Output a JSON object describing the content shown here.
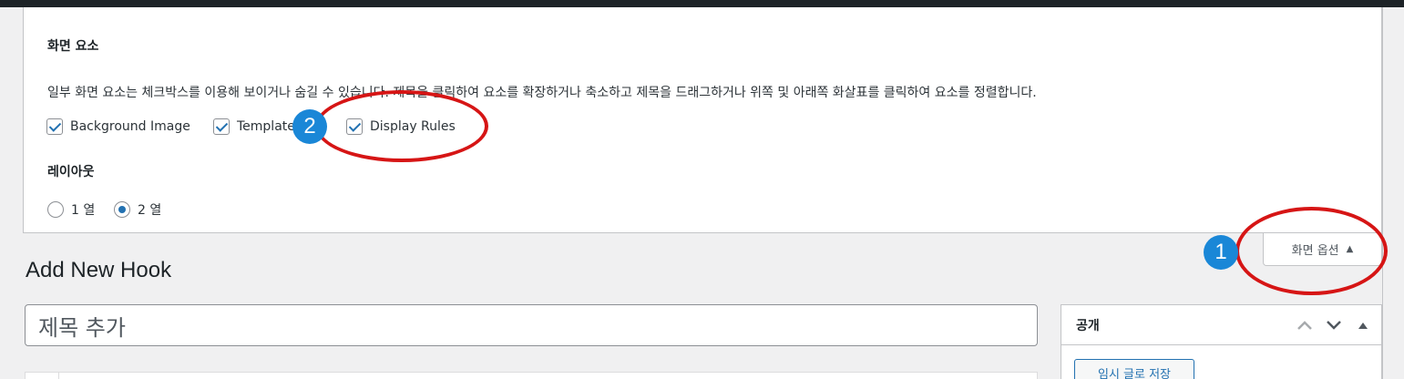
{
  "screen_options": {
    "heading": "화면 요소",
    "description": "일부 화면 요소는 체크박스를 이용해 보이거나 숨길 수 있습니다. 제목을 클릭하여 요소를 확장하거나 축소하고 제목을 드래그하거나 위쪽 및 아래쪽 화살표를 클릭하여 요소를 정렬합니다.",
    "checkboxes": [
      {
        "label": "Background Image",
        "checked": true
      },
      {
        "label": "Template",
        "checked": true
      },
      {
        "label": "Display Rules",
        "checked": true
      }
    ],
    "layout_heading": "레이아웃",
    "layout_options": [
      {
        "label": "1 열",
        "checked": false
      },
      {
        "label": "2 열",
        "checked": true
      }
    ],
    "toggle_label": "화면 옵션",
    "toggle_icon": "arrow-up-icon"
  },
  "page": {
    "title": "Add New Hook",
    "title_placeholder": "제목 추가"
  },
  "publish": {
    "heading": "공개",
    "save_draft_label": "임시 글로 저장",
    "controls": [
      "chevron-up-icon",
      "chevron-down-icon",
      "triangle-up-icon"
    ]
  },
  "annotations": [
    {
      "number": "1",
      "color": "#1a87d7",
      "ring_color": "#d61515"
    },
    {
      "number": "2",
      "color": "#1a87d7",
      "ring_color": "#d61515"
    }
  ]
}
